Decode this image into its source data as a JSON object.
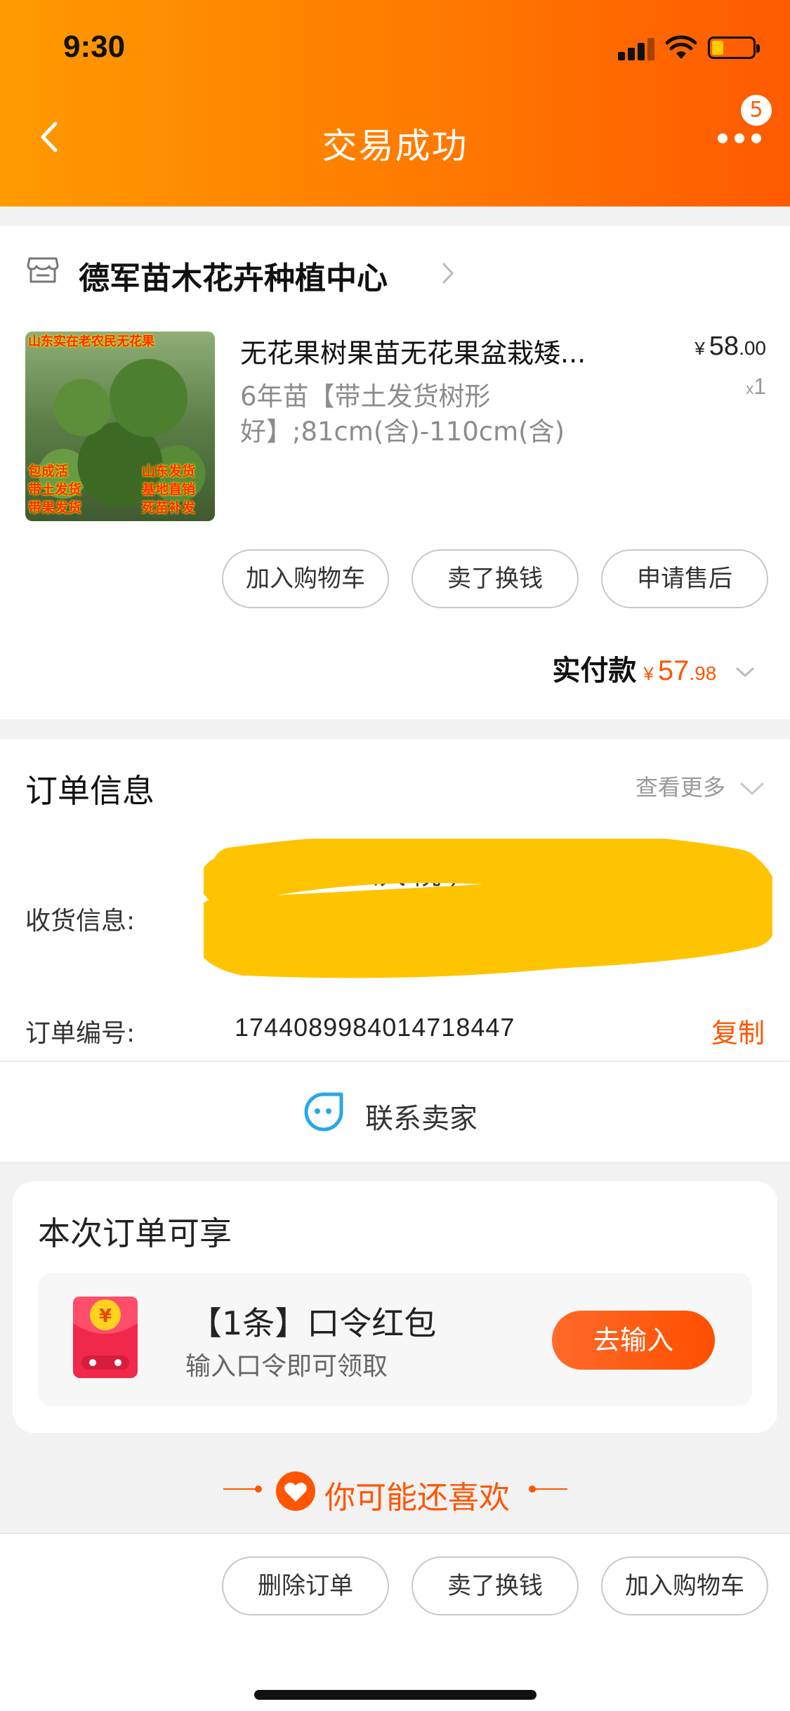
{
  "status_bar": {
    "time": "9:30"
  },
  "header": {
    "title": "交易成功",
    "badge_count": "5"
  },
  "shop": {
    "name": "德军苗木花卉种植中心",
    "product": {
      "title": "无花果树果苗无花果盆栽矮...",
      "spec": "6年苗【带土发货树形好】;81cm(含)-110cm(含)",
      "price_currency": "¥",
      "price_int": "58",
      "price_dec": ".00",
      "qty_prefix": "x",
      "qty": "1",
      "image_captions": {
        "top": "山东实在老农民无花果",
        "left1": "包成活",
        "left2": "带土发货",
        "left3": "带果发货",
        "right1": "山东发货",
        "right2": "基地直销",
        "right3": "死苗补发"
      }
    },
    "actions": [
      "加入购物车",
      "卖了换钱",
      "申请售后"
    ],
    "total": {
      "label": "实付款",
      "currency": "¥",
      "int": "57",
      "dec": ".98"
    }
  },
  "order_info": {
    "title": "订单信息",
    "more": "查看更多",
    "receiver_label": "收货信息:",
    "receiver_visible": "市 部（第四人 院 ）",
    "order_no_label": "订单编号:",
    "order_no": "1744089984014718447",
    "copy": "复制",
    "contact": "联系卖家"
  },
  "benefits": {
    "title": "本次订单可享",
    "coupon_title": "【1条】口令红包",
    "coupon_sub": "输入口令即可领取",
    "coupon_button": "去输入"
  },
  "recommend": {
    "label": "你可能还喜欢"
  },
  "bottom_actions": [
    "删除订单",
    "卖了换钱",
    "加入购物车"
  ],
  "colors": {
    "accent": "#ff5500",
    "header_start": "#ff9a00",
    "header_end": "#ff5a00",
    "redaction": "#ffc400"
  }
}
